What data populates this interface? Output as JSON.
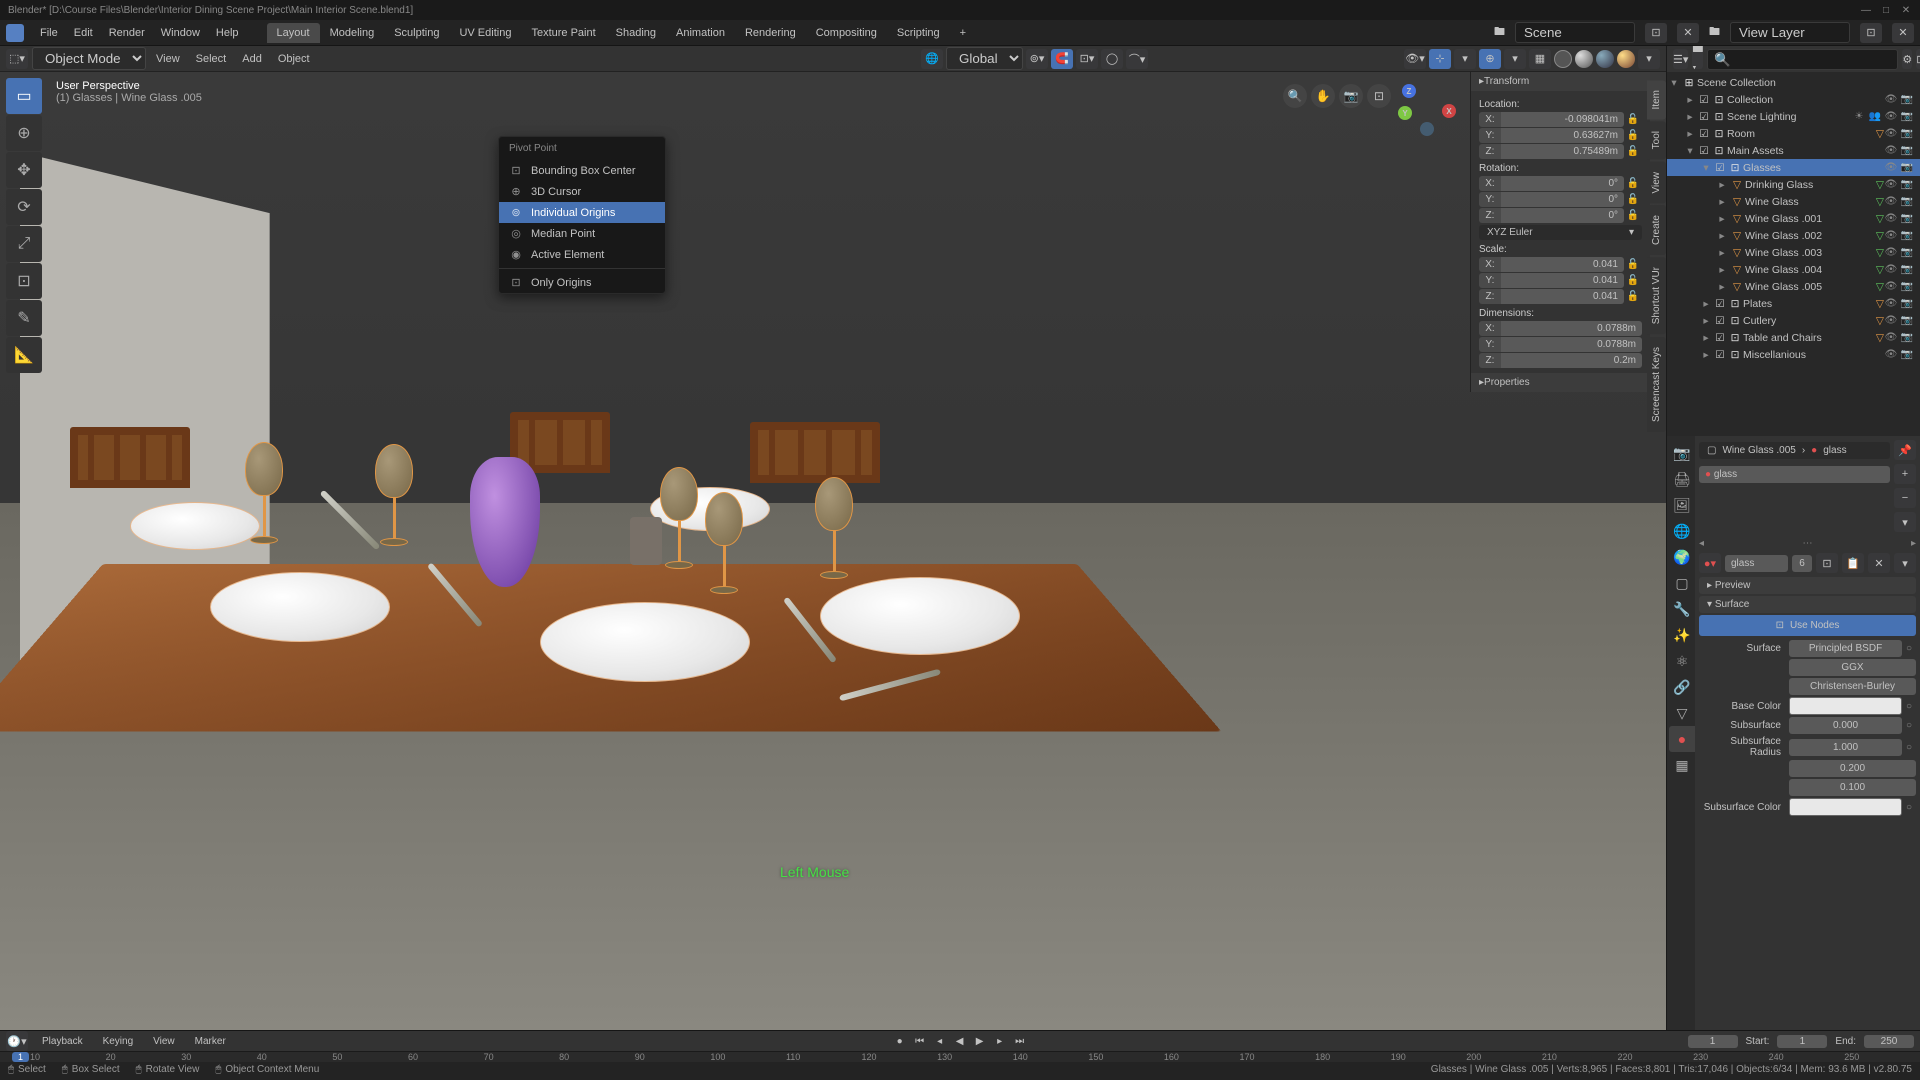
{
  "titlebar": {
    "title": "Blender* [D:\\Course Files\\Blender\\Interior Dining Scene Project\\Main Interior Scene.blend1]"
  },
  "menubar": {
    "items": [
      "File",
      "Edit",
      "Render",
      "Window",
      "Help"
    ],
    "tabs": [
      "Layout",
      "Modeling",
      "Sculpting",
      "UV Editing",
      "Texture Paint",
      "Shading",
      "Animation",
      "Rendering",
      "Compositing",
      "Scripting"
    ],
    "active_tab": 0,
    "scene_label": "Scene",
    "layer_label": "View Layer"
  },
  "viewport_header": {
    "mode": "Object Mode",
    "menus": [
      "View",
      "Select",
      "Add",
      "Object"
    ],
    "orientation": "Global"
  },
  "viewport_info": {
    "line1": "User Perspective",
    "line2": "(1) Glasses | Wine Glass .005"
  },
  "pivot_popup": {
    "title": "Pivot Point",
    "items": [
      {
        "icon": "⊡",
        "label": "Bounding Box Center",
        "selected": false
      },
      {
        "icon": "⊕",
        "label": "3D Cursor",
        "selected": false
      },
      {
        "icon": "⊚",
        "label": "Individual Origins",
        "selected": true
      },
      {
        "icon": "◎",
        "label": "Median Point",
        "selected": false
      },
      {
        "icon": "◉",
        "label": "Active Element",
        "selected": false
      }
    ],
    "only_origins": "Only Origins"
  },
  "npanel": {
    "tabs": [
      "Item",
      "Tool",
      "View",
      "Create",
      "Shortcut VUr",
      "Screencast Keys"
    ],
    "transform_header": "Transform",
    "location": {
      "label": "Location:",
      "x": "-0.098041m",
      "y": "0.63627m",
      "z": "0.75489m"
    },
    "rotation": {
      "label": "Rotation:",
      "x": "0°",
      "y": "0°",
      "z": "0°",
      "mode": "XYZ Euler"
    },
    "scale": {
      "label": "Scale:",
      "x": "0.041",
      "y": "0.041",
      "z": "0.041"
    },
    "dimensions": {
      "label": "Dimensions:",
      "x": "0.0788m",
      "y": "0.0788m",
      "z": "0.2m"
    },
    "properties_header": "Properties"
  },
  "outliner": {
    "tree": [
      {
        "depth": 0,
        "expand": "▾",
        "check": false,
        "icon": "⊞",
        "icon_class": "col-icon",
        "name": "Scene Collection",
        "ctrl": []
      },
      {
        "depth": 1,
        "expand": "▸",
        "check": true,
        "icon": "⊡",
        "icon_class": "col-icon",
        "name": "Collection",
        "ctrl": [
          "👁",
          "📷"
        ]
      },
      {
        "depth": 1,
        "expand": "▸",
        "check": true,
        "icon": "⊡",
        "icon_class": "col-icon",
        "name": "Scene Lighting",
        "ctrl": [
          "☀",
          "👥",
          "👁",
          "📷"
        ]
      },
      {
        "depth": 1,
        "expand": "▸",
        "check": true,
        "icon": "⊡",
        "icon_class": "col-icon",
        "name": "Room",
        "extra_icon": "▽",
        "ctrl": [
          "👁",
          "📷"
        ]
      },
      {
        "depth": 1,
        "expand": "▾",
        "check": true,
        "icon": "⊡",
        "icon_class": "col-icon",
        "name": "Main Assets",
        "ctrl": [
          "👁",
          "📷"
        ]
      },
      {
        "depth": 2,
        "expand": "▾",
        "check": true,
        "icon": "⊡",
        "icon_class": "col-icon",
        "name": "Glasses",
        "selected": true,
        "ctrl": [
          "👁",
          "📷"
        ]
      },
      {
        "depth": 3,
        "expand": "▸",
        "check": false,
        "icon": "▽",
        "icon_class": "obj-icon",
        "name": "Drinking Glass",
        "mesh": true,
        "ctrl": [
          "👁",
          "📷"
        ]
      },
      {
        "depth": 3,
        "expand": "▸",
        "check": false,
        "icon": "▽",
        "icon_class": "obj-icon",
        "name": "Wine Glass",
        "mesh": true,
        "ctrl": [
          "👁",
          "📷"
        ]
      },
      {
        "depth": 3,
        "expand": "▸",
        "check": false,
        "icon": "▽",
        "icon_class": "obj-icon",
        "name": "Wine Glass .001",
        "mesh": true,
        "ctrl": [
          "👁",
          "📷"
        ]
      },
      {
        "depth": 3,
        "expand": "▸",
        "check": false,
        "icon": "▽",
        "icon_class": "obj-icon",
        "name": "Wine Glass .002",
        "mesh": true,
        "ctrl": [
          "👁",
          "📷"
        ]
      },
      {
        "depth": 3,
        "expand": "▸",
        "check": false,
        "icon": "▽",
        "icon_class": "obj-icon",
        "name": "Wine Glass .003",
        "mesh": true,
        "ctrl": [
          "👁",
          "📷"
        ]
      },
      {
        "depth": 3,
        "expand": "▸",
        "check": false,
        "icon": "▽",
        "icon_class": "obj-icon",
        "name": "Wine Glass .004",
        "mesh": true,
        "ctrl": [
          "👁",
          "📷"
        ]
      },
      {
        "depth": 3,
        "expand": "▸",
        "check": false,
        "icon": "▽",
        "icon_class": "obj-icon",
        "name": "Wine Glass .005",
        "mesh": true,
        "ctrl": [
          "👁",
          "📷"
        ]
      },
      {
        "depth": 2,
        "expand": "▸",
        "check": true,
        "icon": "⊡",
        "icon_class": "col-icon",
        "name": "Plates",
        "extra_icon": "▽",
        "ctrl": [
          "👁",
          "📷"
        ]
      },
      {
        "depth": 2,
        "expand": "▸",
        "check": true,
        "icon": "⊡",
        "icon_class": "col-icon",
        "name": "Cutlery",
        "extra_icon": "▽",
        "ctrl": [
          "👁",
          "📷"
        ]
      },
      {
        "depth": 2,
        "expand": "▸",
        "check": true,
        "icon": "⊡",
        "icon_class": "col-icon",
        "name": "Table and Chairs",
        "extra_icon": "▽",
        "ctrl": [
          "👁",
          "📷"
        ]
      },
      {
        "depth": 2,
        "expand": "▸",
        "check": true,
        "icon": "⊡",
        "icon_class": "col-icon",
        "name": "Miscellanious",
        "ctrl": [
          "👁",
          "📷"
        ]
      }
    ]
  },
  "properties": {
    "breadcrumb_obj": "Wine Glass .005",
    "breadcrumb_mat": "glass",
    "material_name": "glass",
    "material_data": "glass",
    "data_users": "6",
    "preview_label": "Preview",
    "surface_label": "Surface",
    "use_nodes": "Use Nodes",
    "surface_field": {
      "k": "Surface",
      "v": "Principled BSDF"
    },
    "distrib": {
      "v": "GGX"
    },
    "sss_method": {
      "v": "Christensen-Burley"
    },
    "base_color": {
      "k": "Base Color"
    },
    "subsurface": {
      "k": "Subsurface",
      "v": "0.000"
    },
    "subsurface_radius": {
      "k": "Subsurface Radius",
      "v1": "1.000",
      "v2": "0.200",
      "v3": "0.100"
    },
    "subsurface_color": {
      "k": "Subsurface Color"
    }
  },
  "timeline": {
    "menus": [
      "Playback",
      "Keying",
      "View",
      "Marker"
    ],
    "current": "1",
    "start_label": "Start:",
    "start": "1",
    "end_label": "End:",
    "end": "250",
    "ticks": [
      "10",
      "20",
      "30",
      "40",
      "50",
      "60",
      "70",
      "80",
      "90",
      "100",
      "110",
      "120",
      "130",
      "140",
      "150",
      "160",
      "170",
      "180",
      "190",
      "200",
      "210",
      "220",
      "230",
      "240",
      "250"
    ]
  },
  "statusbar": {
    "select": "Select",
    "box_select": "Box Select",
    "rotate": "Rotate View",
    "context": "Object Context Menu",
    "right": "Glasses | Wine Glass .005 | Verts:8,965 | Faces:8,801 | Tris:17,046 | Objects:6/34 | Mem: 93.6 MB | v2.80.75"
  },
  "overlay": "Left Mouse"
}
